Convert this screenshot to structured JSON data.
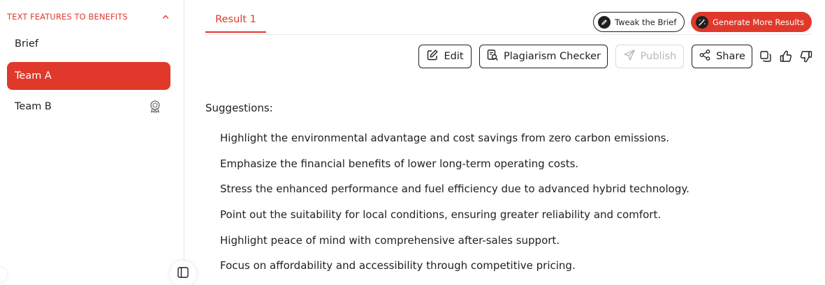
{
  "sidebar": {
    "section_title": "TEXT FEATURES TO BENEFITS",
    "items": [
      {
        "label": "Brief"
      },
      {
        "label": "Team A"
      },
      {
        "label": "Team B"
      }
    ]
  },
  "tabs": [
    {
      "label": "Result 1"
    }
  ],
  "header_actions": {
    "tweak": "Tweak the Brief",
    "generate": "Generate More Results"
  },
  "toolbar": {
    "edit": "Edit",
    "plagiarism": "Plagiarism Checker",
    "publish": "Publish",
    "share": "Share"
  },
  "content": {
    "title": "Suggestions:",
    "items": [
      "Highlight the environmental advantage and cost savings from zero carbon emissions.",
      "Emphasize the financial benefits of lower long-term operating costs.",
      "Stress the enhanced performance and fuel efficiency due to advanced hybrid technology.",
      "Point out the suitability for local conditions, ensuring greater reliability and comfort.",
      "Highlight peace of mind with comprehensive after-sales support.",
      "Focus on affordability and accessibility through competitive pricing."
    ]
  },
  "colors": {
    "accent": "#e0392b",
    "text": "#1f1f1f",
    "disabled": "#b8b8b8"
  }
}
